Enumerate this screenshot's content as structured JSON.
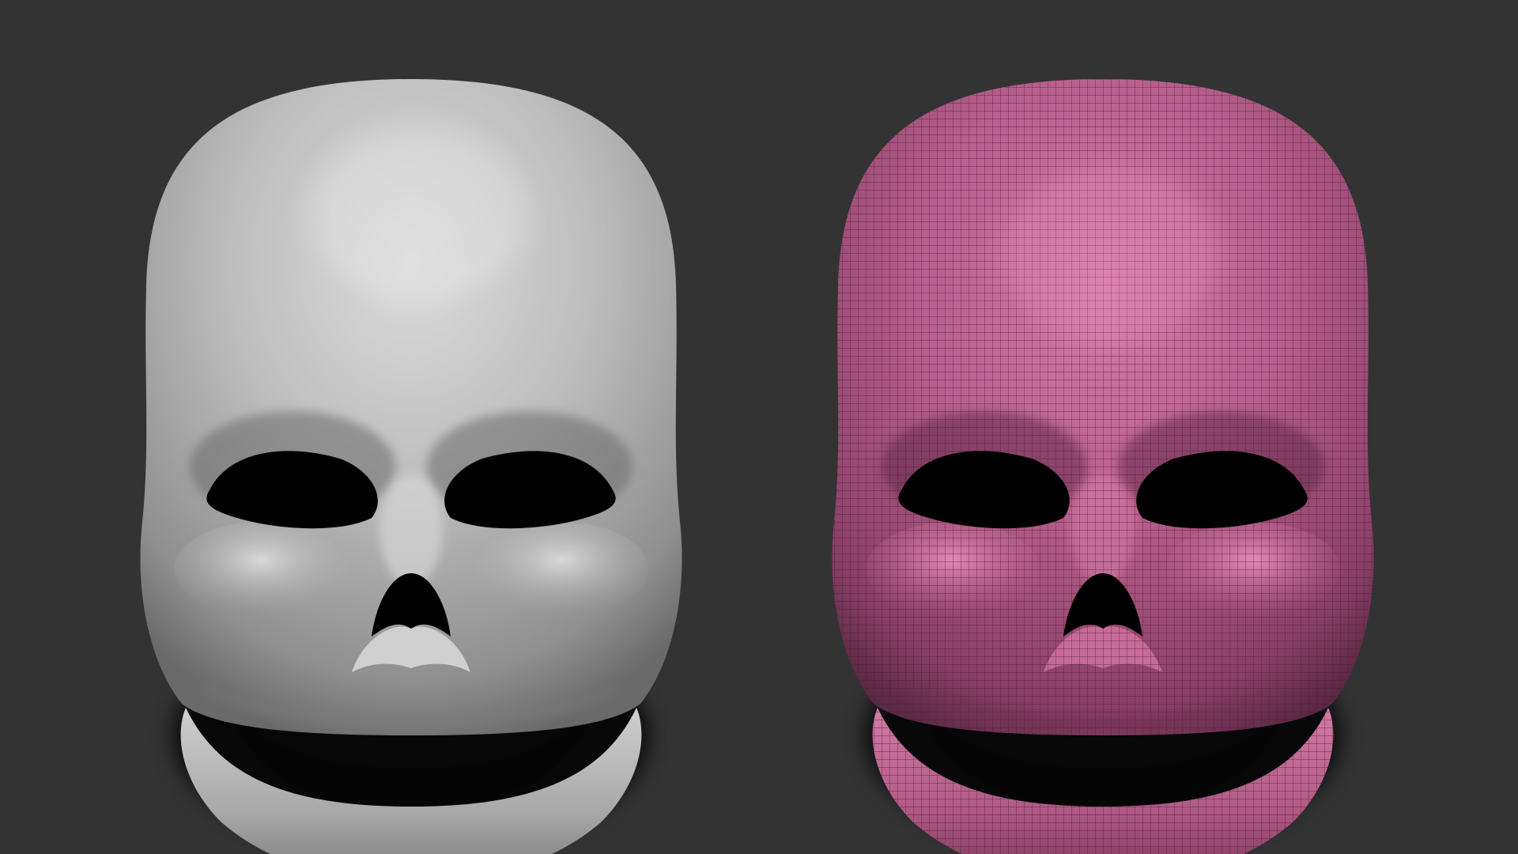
{
  "scene": {
    "background_color": "#333333",
    "models": [
      {
        "name": "smooth-skull",
        "material": "matcap-gray",
        "base_color": "#b9b9b9",
        "highlight_color": "#e2e2e2",
        "shadow_color": "#5e5e5e",
        "wireframe": false
      },
      {
        "name": "wireframe-skull",
        "material": "pink-polypaint",
        "base_color": "#b85e8c",
        "highlight_color": "#e28ab5",
        "shadow_color": "#5c2844",
        "wireframe": true,
        "wire_color": "#3e1f30"
      }
    ]
  }
}
